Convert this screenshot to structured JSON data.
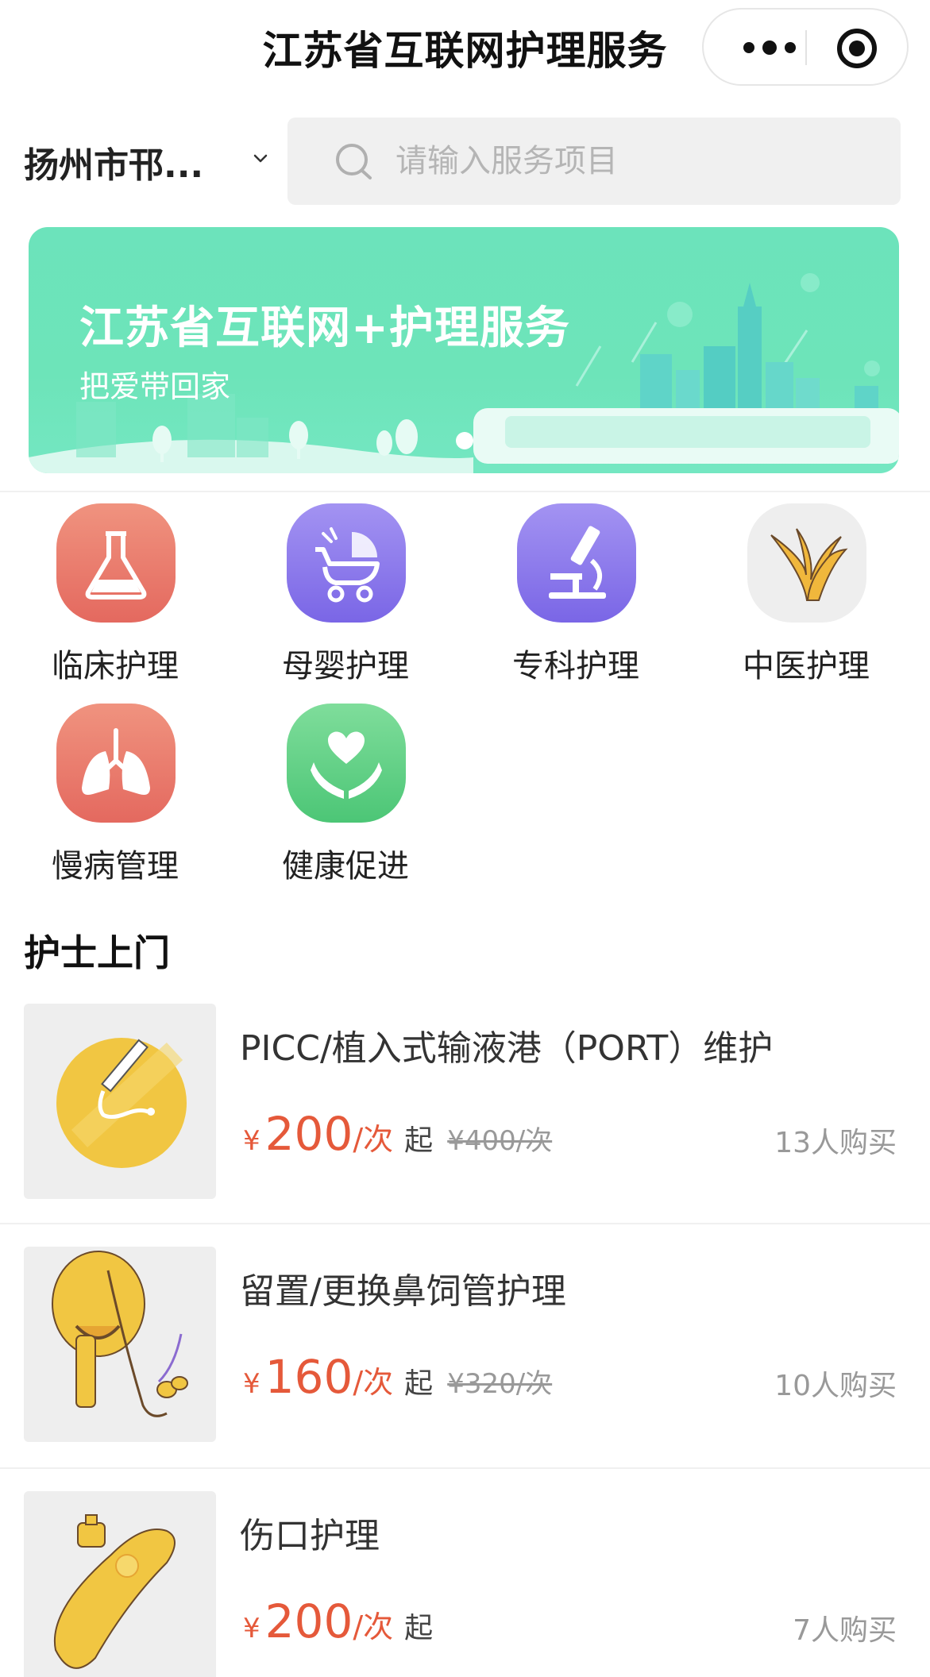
{
  "navbar": {
    "title": "江苏省互联网护理服务"
  },
  "location": {
    "label": "扬州市邗..."
  },
  "search": {
    "placeholder": "请输入服务项目"
  },
  "banner": {
    "title": "江苏省互联网+护理服务",
    "subtitle": "把爱带回家"
  },
  "categories": [
    {
      "label": "临床护理",
      "icon": "flask-icon",
      "color": "#e9776a"
    },
    {
      "label": "母婴护理",
      "icon": "stroller-icon",
      "color": "#8b78ec"
    },
    {
      "label": "专科护理",
      "icon": "microscope-icon",
      "color": "#8b78ec"
    },
    {
      "label": "中医护理",
      "icon": "herb-icon",
      "color": "#eeeeee"
    },
    {
      "label": "慢病管理",
      "icon": "lungs-icon",
      "color": "#e9776a"
    },
    {
      "label": "健康促进",
      "icon": "heart-hands-icon",
      "color": "#5fce85"
    }
  ],
  "section": {
    "title": "护士上门"
  },
  "services": [
    {
      "name": "PICC/植入式输液港（PORT）维护",
      "currency": "¥",
      "price": "200",
      "unit": "/次",
      "from": "起",
      "original": "¥400/次",
      "buyers": "13人购买"
    },
    {
      "name": "留置/更换鼻饲管护理",
      "currency": "¥",
      "price": "160",
      "unit": "/次",
      "from": "起",
      "original": "¥320/次",
      "buyers": "10人购买"
    },
    {
      "name": "伤口护理",
      "currency": "¥",
      "price": "200",
      "unit": "/次",
      "from": "起",
      "original": "",
      "buyers": "7人购买"
    }
  ],
  "colors": {
    "accent": "#e5593a",
    "banner": "#6ce3bb"
  }
}
